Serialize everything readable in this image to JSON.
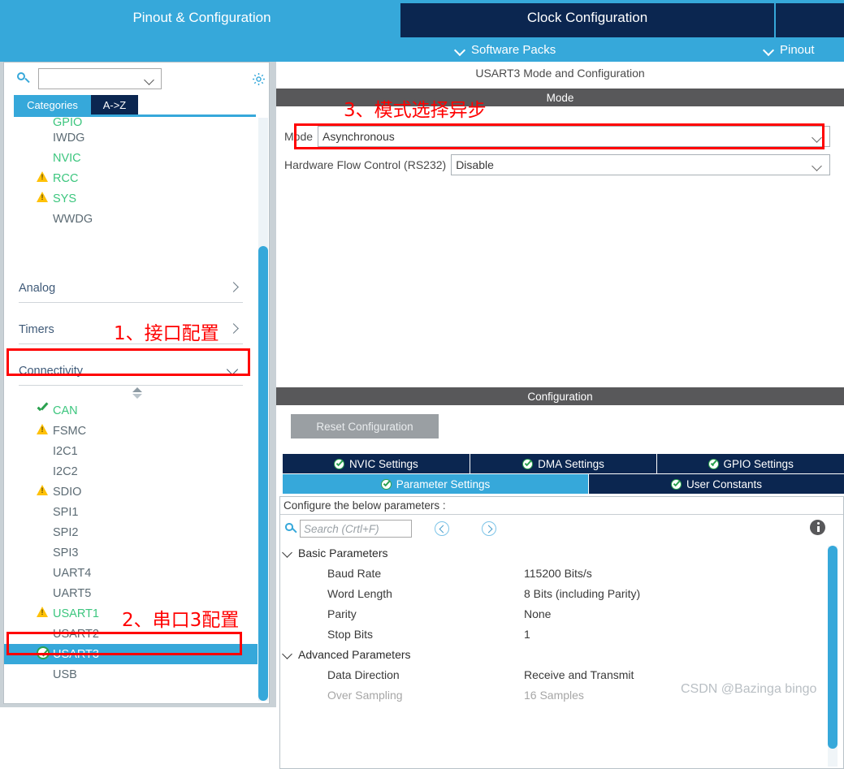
{
  "window": {
    "main_tabs": [
      {
        "label": "Pinout & Configuration",
        "selected": true
      },
      {
        "label": "Clock Configuration",
        "selected": false
      },
      {
        "label": "",
        "selected": false
      }
    ],
    "sub_items": [
      {
        "label": "Software Packs"
      },
      {
        "label": "Pinout"
      }
    ]
  },
  "sidebar": {
    "search": {
      "value": "",
      "icon": "search-icon"
    },
    "gear_icon": "gear-icon",
    "tabs": [
      {
        "label": "Categories",
        "selected": true
      },
      {
        "label": "A->Z",
        "selected": false
      }
    ],
    "system_items": [
      {
        "label": "GPIO",
        "status": "green",
        "icon": "none"
      },
      {
        "label": "IWDG",
        "status": "normal",
        "icon": "none"
      },
      {
        "label": "NVIC",
        "status": "green",
        "icon": "none"
      },
      {
        "label": "RCC",
        "status": "green",
        "icon": "warning-icon"
      },
      {
        "label": "SYS",
        "status": "green",
        "icon": "warning-icon"
      },
      {
        "label": "WWDG",
        "status": "normal",
        "icon": "none"
      }
    ],
    "groups": [
      {
        "label": "Analog",
        "expanded": false
      },
      {
        "label": "Timers",
        "expanded": false
      },
      {
        "label": "Connectivity",
        "expanded": true
      }
    ],
    "connectivity_items": [
      {
        "label": "CAN",
        "status": "green",
        "icon": "check-icon"
      },
      {
        "label": "FSMC",
        "status": "normal",
        "icon": "warning-icon"
      },
      {
        "label": "I2C1",
        "status": "normal",
        "icon": "none"
      },
      {
        "label": "I2C2",
        "status": "normal",
        "icon": "none"
      },
      {
        "label": "SDIO",
        "status": "normal",
        "icon": "warning-icon"
      },
      {
        "label": "SPI1",
        "status": "normal",
        "icon": "none"
      },
      {
        "label": "SPI2",
        "status": "normal",
        "icon": "none"
      },
      {
        "label": "SPI3",
        "status": "normal",
        "icon": "none"
      },
      {
        "label": "UART4",
        "status": "normal",
        "icon": "none"
      },
      {
        "label": "UART5",
        "status": "normal",
        "icon": "none"
      },
      {
        "label": "USART1",
        "status": "green",
        "icon": "warning-icon"
      },
      {
        "label": "USART2",
        "status": "normal",
        "icon": "none"
      },
      {
        "label": "USART3",
        "status": "selected",
        "icon": "circle-check-icon"
      },
      {
        "label": "USB",
        "status": "normal",
        "icon": "none"
      }
    ]
  },
  "right": {
    "title": "USART3 Mode and Configuration",
    "mode_section_label": "Mode",
    "mode_row": {
      "label": "Mode",
      "value": "Asynchronous"
    },
    "hwflow_row": {
      "label": "Hardware Flow Control (RS232)",
      "value": "Disable"
    },
    "config_section_label": "Configuration",
    "reset_button": "Reset Configuration",
    "tabs_row1": [
      {
        "label": "NVIC Settings",
        "active": false
      },
      {
        "label": "DMA Settings",
        "active": false
      },
      {
        "label": "GPIO Settings",
        "active": false
      }
    ],
    "tabs_row2": [
      {
        "label": "Parameter Settings",
        "active": true
      },
      {
        "label": "User Constants",
        "active": false
      }
    ],
    "hint": "Configure the below parameters :",
    "param_search_placeholder": "Search (Crtl+F)",
    "nav_prev_icon": "chevron-left-circle-icon",
    "nav_next_icon": "chevron-right-circle-icon",
    "info_icon": "info-icon",
    "parameters": [
      {
        "type": "group",
        "name": "Basic Parameters",
        "value": ""
      },
      {
        "type": "item",
        "name": "Baud Rate",
        "value": "115200 Bits/s"
      },
      {
        "type": "item",
        "name": "Word Length",
        "value": "8 Bits (including Parity)"
      },
      {
        "type": "item",
        "name": "Parity",
        "value": "None"
      },
      {
        "type": "item",
        "name": "Stop Bits",
        "value": "1"
      },
      {
        "type": "group",
        "name": "Advanced Parameters",
        "value": ""
      },
      {
        "type": "item",
        "name": "Data Direction",
        "value": "Receive and Transmit"
      },
      {
        "type": "item",
        "name": "Over Sampling",
        "value": "16 Samples",
        "faded": true
      }
    ]
  },
  "annotations": [
    {
      "id": "anno-1",
      "text": "1、接口配置"
    },
    {
      "id": "anno-2",
      "text": "2、串口3配置"
    },
    {
      "id": "anno-3",
      "text": "3、模式选择异步"
    }
  ],
  "watermark": "CSDN @Bazinga bingo",
  "colors": {
    "accent_blue": "#36a8da",
    "dark_navy": "#0b2650",
    "section_gray": "#58585a",
    "green": "#3cc67e",
    "warning_yellow": "#ffc107",
    "annotation_red": "#ff0000"
  }
}
